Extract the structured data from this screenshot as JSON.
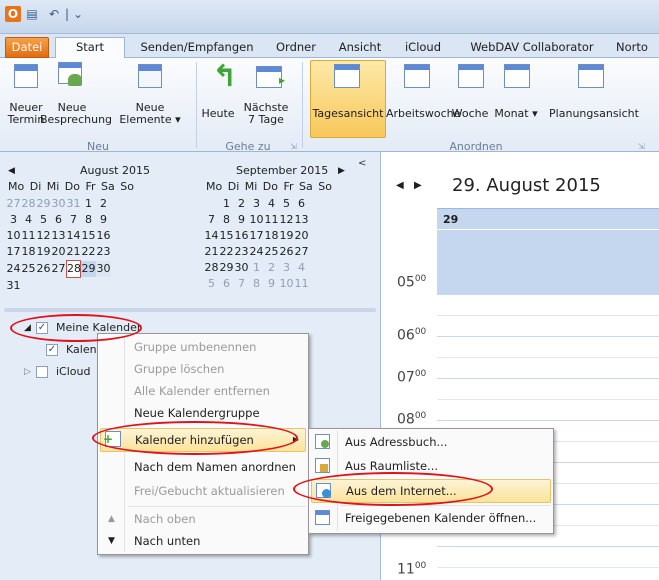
{
  "qat": {
    "undo": "↶",
    "dropdown": "⌄"
  },
  "tabs": [
    "Datei",
    "Start",
    "Senden/Empfangen",
    "Ordner",
    "Ansicht",
    "iCloud",
    "WebDAV Collaborator",
    "Norto"
  ],
  "ribbon": {
    "neu": {
      "new_appt": "Neuer\nTermin",
      "new_meeting": "Neue\nBesprechung",
      "new_items": "Neue\nElemente ▾",
      "group": "Neu"
    },
    "gehe_zu": {
      "today": "Heute",
      "next7": "Nächste\n7 Tage",
      "group": "Gehe zu"
    },
    "anordnen": {
      "day": "Tagesansicht",
      "workweek": "Arbeitswoche",
      "week": "Woche",
      "month": "Monat ▾",
      "schedule": "Planungsansicht",
      "group": "Anordnen"
    }
  },
  "mini_cal": {
    "aug_title": "August 2015",
    "sep_title": "September 2015",
    "weekdays": "Mo Di Mi Do Fr Sa So",
    "aug_rows": [
      [
        "27",
        "28",
        "29",
        "30",
        "31",
        "1",
        "2"
      ],
      [
        "3",
        "4",
        "5",
        "6",
        "7",
        "8",
        "9"
      ],
      [
        "10",
        "11",
        "12",
        "13",
        "14",
        "15",
        "16"
      ],
      [
        "17",
        "18",
        "19",
        "20",
        "21",
        "22",
        "23"
      ],
      [
        "24",
        "25",
        "26",
        "27",
        "28",
        "29",
        "30"
      ],
      [
        "31",
        "",
        "",
        "",
        "",
        "",
        ""
      ]
    ],
    "sep_rows": [
      [
        "",
        "1",
        "2",
        "3",
        "4",
        "5",
        "6"
      ],
      [
        "7",
        "8",
        "9",
        "10",
        "11",
        "12",
        "13"
      ],
      [
        "14",
        "15",
        "16",
        "17",
        "18",
        "19",
        "20"
      ],
      [
        "21",
        "22",
        "23",
        "24",
        "25",
        "26",
        "27"
      ],
      [
        "28",
        "29",
        "30",
        "1",
        "2",
        "3",
        "4"
      ],
      [
        "5",
        "6",
        "7",
        "8",
        "9",
        "10",
        "11"
      ]
    ]
  },
  "folders": {
    "my_calendars": "Meine Kalender",
    "calendar": "Kalender",
    "icloud": "iCloud"
  },
  "calendar_view": {
    "date_title": "29. August 2015",
    "day_num": "29",
    "hours": [
      "05",
      "06",
      "07",
      "08",
      "11"
    ],
    "hour_suffix": "00"
  },
  "context_menu": {
    "items": [
      "Gruppe umbenennen",
      "Gruppe löschen",
      "Alle Kalender entfernen",
      "Neue Kalendergruppe",
      "Kalender hinzufügen",
      "Nach dem Namen anordnen",
      "Frei/Gebucht aktualisieren",
      "Nach oben",
      "Nach unten"
    ]
  },
  "submenu": {
    "items": [
      "Aus Adressbuch...",
      "Aus Raumliste...",
      "Aus dem Internet...",
      "Freigegebenen Kalender öffnen..."
    ]
  }
}
